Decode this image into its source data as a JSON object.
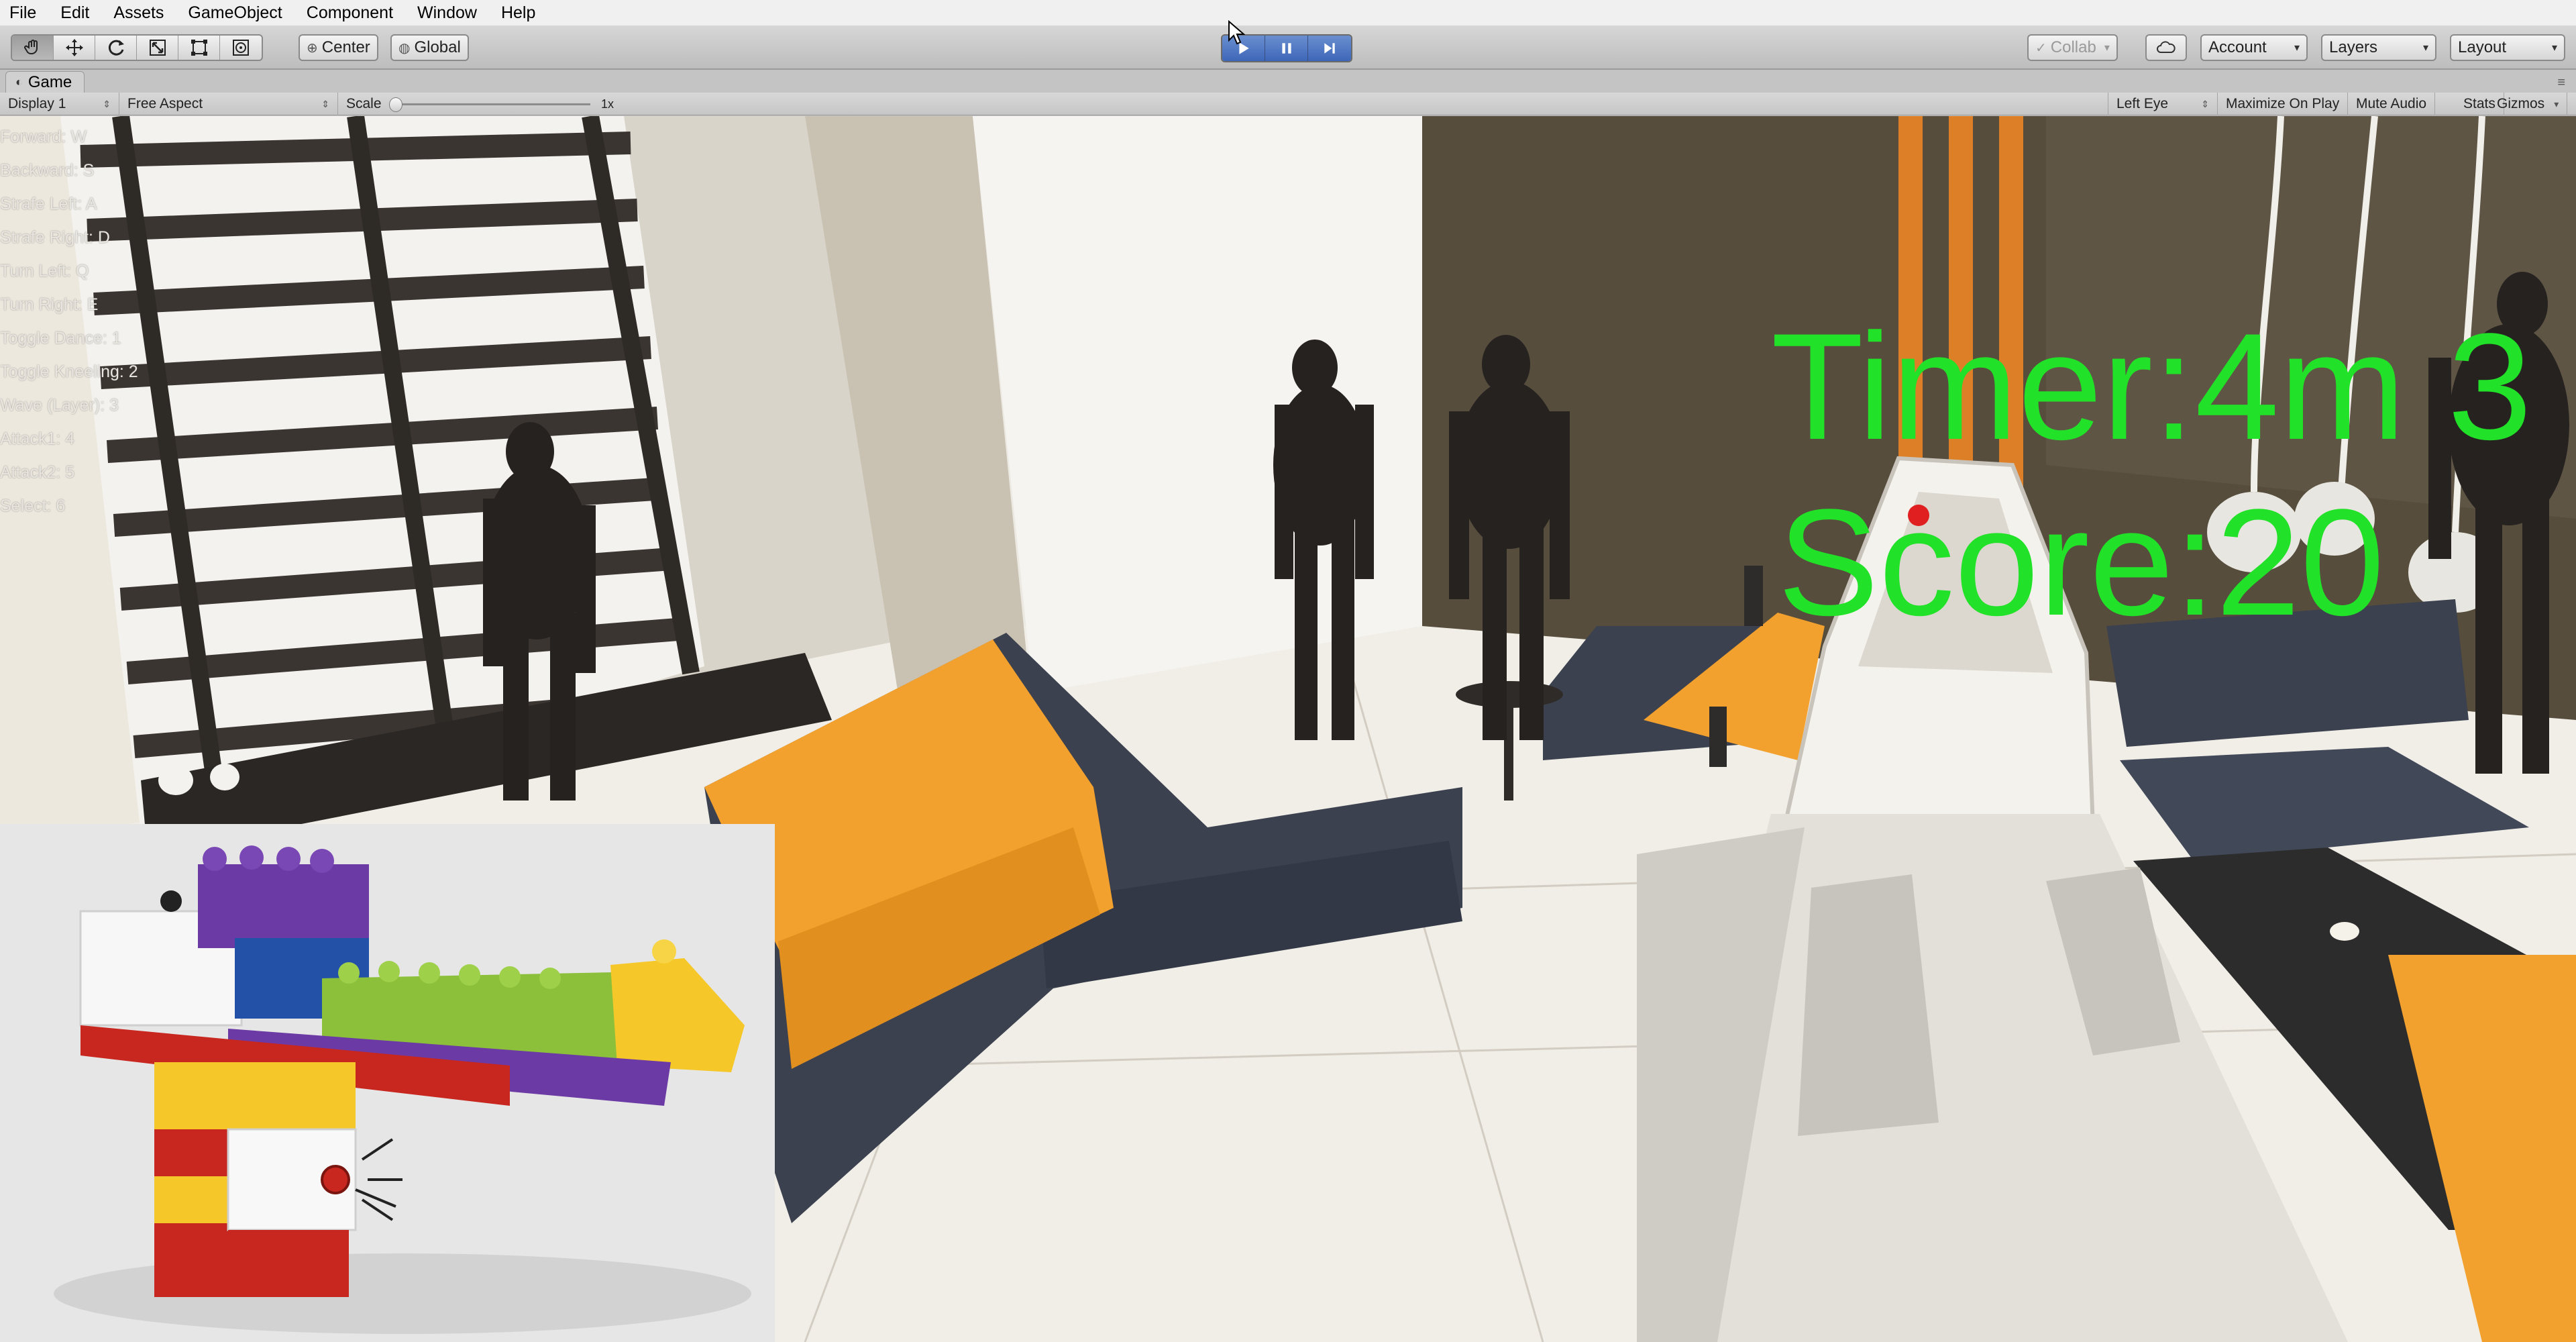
{
  "menu": [
    "File",
    "Edit",
    "Assets",
    "GameObject",
    "Component",
    "Window",
    "Help"
  ],
  "toolbar": {
    "transform_tools": [
      "hand-tool",
      "move-tool",
      "rotate-tool",
      "scale-tool",
      "rect-tool",
      "transform-tool"
    ],
    "pivot_label": "Center",
    "space_label": "Global",
    "collab_label": "Collab",
    "account_label": "Account",
    "layers_label": "Layers",
    "layout_label": "Layout",
    "play_active": true
  },
  "game_view": {
    "tab_label": "Game",
    "display": "Display 1",
    "aspect": "Free Aspect",
    "scale_label": "Scale",
    "scale_value": "1x",
    "eye": "Left Eye",
    "options": [
      "Maximize On Play",
      "Mute Audio",
      "Stats",
      "Gizmos"
    ]
  },
  "controls_help": [
    "Forward: W",
    "Backward: S",
    "Strafe Left: A",
    "Strafe Right: D",
    "Turn Left: Q",
    "Turn Right: E",
    "Toggle Dance: 1",
    "Toggle Kneeling: 2",
    "Wave (Layer): 3",
    "Attack1: 4",
    "Attack2: 5",
    "Select: 6"
  ],
  "hud": {
    "timer": "Timer:4m 3",
    "score": "Score:20",
    "color": "#21e128"
  },
  "colors": {
    "sofa_orange": "#f2a12e",
    "sofa_dark": "#3b414e",
    "floor": "#f1eee8",
    "wall_dark": "#564d3c",
    "pipe_orange": "#dd7f27",
    "lego_purple": "#6b3aa4",
    "lego_green": "#8cc03a",
    "lego_yellow": "#f5c728",
    "lego_red": "#c8271f",
    "lego_blue": "#2451a8"
  }
}
